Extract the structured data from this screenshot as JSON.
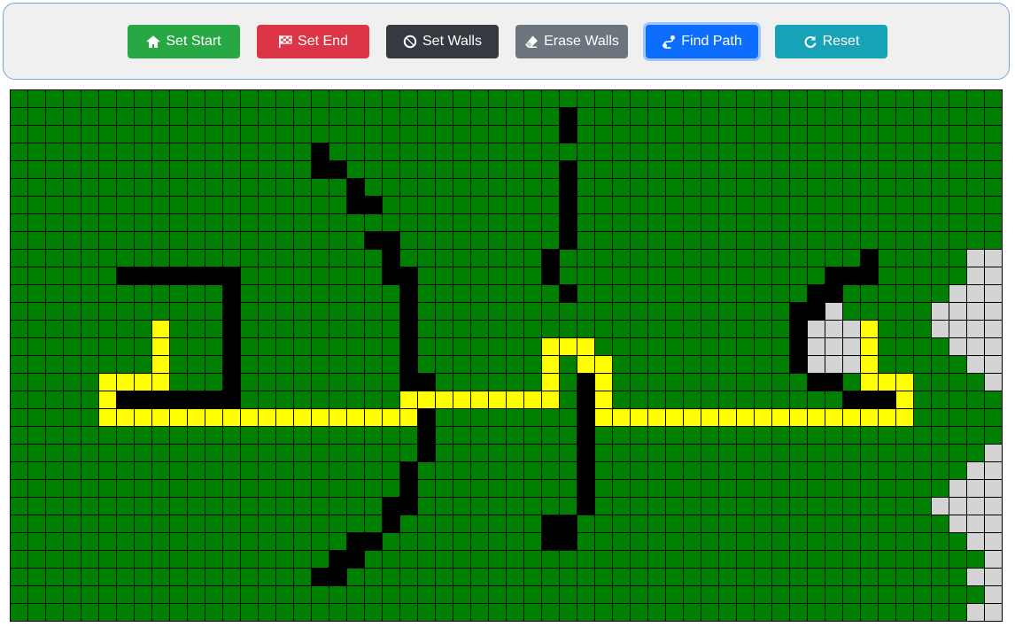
{
  "toolbar": {
    "buttons": [
      {
        "id": "set-start",
        "label": "Set Start",
        "icon": "home-icon",
        "color": "#28a745"
      },
      {
        "id": "set-end",
        "label": "Set End",
        "icon": "checkered-flag-icon",
        "color": "#dc3545"
      },
      {
        "id": "set-walls",
        "label": "Set Walls",
        "icon": "ban-icon",
        "color": "#343a40"
      },
      {
        "id": "erase-walls",
        "label": "Erase Walls",
        "icon": "eraser-icon",
        "color": "#6c757d"
      },
      {
        "id": "find-path",
        "label": "Find Path",
        "icon": "route-icon",
        "color": "#0d6efd"
      },
      {
        "id": "reset",
        "label": "Reset",
        "icon": "redo-icon",
        "color": "#17a2b8"
      }
    ]
  },
  "grid": {
    "cols": 56,
    "rows": 30,
    "colors": {
      "open": "#008000",
      "wall": "#000000",
      "path": "#ffff00",
      "visited": "#d3d3d3"
    },
    "walls": [
      [
        31,
        1
      ],
      [
        31,
        2
      ],
      [
        17,
        3
      ],
      [
        17,
        4
      ],
      [
        18,
        4
      ],
      [
        31,
        4
      ],
      [
        19,
        5
      ],
      [
        31,
        5
      ],
      [
        19,
        6
      ],
      [
        20,
        6
      ],
      [
        31,
        6
      ],
      [
        31,
        7
      ],
      [
        20,
        8
      ],
      [
        21,
        8
      ],
      [
        31,
        8
      ],
      [
        21,
        9
      ],
      [
        30,
        9
      ],
      [
        48,
        9
      ],
      [
        6,
        10
      ],
      [
        7,
        10
      ],
      [
        8,
        10
      ],
      [
        9,
        10
      ],
      [
        10,
        10
      ],
      [
        11,
        10
      ],
      [
        12,
        10
      ],
      [
        21,
        10
      ],
      [
        22,
        10
      ],
      [
        30,
        10
      ],
      [
        46,
        10
      ],
      [
        47,
        10
      ],
      [
        48,
        10
      ],
      [
        12,
        11
      ],
      [
        22,
        11
      ],
      [
        31,
        11
      ],
      [
        45,
        11
      ],
      [
        46,
        11
      ],
      [
        12,
        12
      ],
      [
        22,
        12
      ],
      [
        44,
        12
      ],
      [
        45,
        12
      ],
      [
        12,
        13
      ],
      [
        22,
        13
      ],
      [
        44,
        13
      ],
      [
        12,
        14
      ],
      [
        22,
        14
      ],
      [
        44,
        14
      ],
      [
        12,
        15
      ],
      [
        22,
        15
      ],
      [
        44,
        15
      ],
      [
        12,
        16
      ],
      [
        22,
        16
      ],
      [
        23,
        16
      ],
      [
        32,
        16
      ],
      [
        45,
        16
      ],
      [
        46,
        16
      ],
      [
        6,
        17
      ],
      [
        7,
        17
      ],
      [
        8,
        17
      ],
      [
        9,
        17
      ],
      [
        10,
        17
      ],
      [
        11,
        17
      ],
      [
        12,
        17
      ],
      [
        32,
        17
      ],
      [
        47,
        17
      ],
      [
        48,
        17
      ],
      [
        49,
        17
      ],
      [
        23,
        18
      ],
      [
        32,
        18
      ],
      [
        23,
        19
      ],
      [
        32,
        19
      ],
      [
        23,
        20
      ],
      [
        32,
        20
      ],
      [
        22,
        21
      ],
      [
        32,
        21
      ],
      [
        22,
        22
      ],
      [
        32,
        22
      ],
      [
        21,
        23
      ],
      [
        22,
        23
      ],
      [
        32,
        23
      ],
      [
        21,
        24
      ],
      [
        30,
        24
      ],
      [
        31,
        24
      ],
      [
        19,
        25
      ],
      [
        20,
        25
      ],
      [
        30,
        25
      ],
      [
        31,
        25
      ],
      [
        18,
        26
      ],
      [
        19,
        26
      ],
      [
        17,
        27
      ],
      [
        18,
        27
      ]
    ],
    "path": [
      [
        8,
        13
      ],
      [
        8,
        14
      ],
      [
        8,
        15
      ],
      [
        5,
        16
      ],
      [
        6,
        16
      ],
      [
        7,
        16
      ],
      [
        8,
        16
      ],
      [
        5,
        17
      ],
      [
        5,
        18
      ],
      [
        6,
        18
      ],
      [
        7,
        18
      ],
      [
        8,
        18
      ],
      [
        9,
        18
      ],
      [
        10,
        18
      ],
      [
        11,
        18
      ],
      [
        12,
        18
      ],
      [
        13,
        18
      ],
      [
        14,
        18
      ],
      [
        15,
        18
      ],
      [
        16,
        18
      ],
      [
        17,
        18
      ],
      [
        18,
        18
      ],
      [
        19,
        18
      ],
      [
        20,
        18
      ],
      [
        21,
        18
      ],
      [
        22,
        18
      ],
      [
        22,
        17
      ],
      [
        23,
        17
      ],
      [
        24,
        17
      ],
      [
        25,
        17
      ],
      [
        26,
        17
      ],
      [
        27,
        17
      ],
      [
        28,
        17
      ],
      [
        29,
        17
      ],
      [
        30,
        17
      ],
      [
        30,
        16
      ],
      [
        30,
        15
      ],
      [
        30,
        14
      ],
      [
        31,
        14
      ],
      [
        32,
        14
      ],
      [
        32,
        15
      ],
      [
        33,
        15
      ],
      [
        33,
        16
      ],
      [
        33,
        17
      ],
      [
        33,
        18
      ],
      [
        34,
        18
      ],
      [
        35,
        18
      ],
      [
        36,
        18
      ],
      [
        37,
        18
      ],
      [
        38,
        18
      ],
      [
        39,
        18
      ],
      [
        40,
        18
      ],
      [
        41,
        18
      ],
      [
        42,
        18
      ],
      [
        43,
        18
      ],
      [
        44,
        18
      ],
      [
        45,
        18
      ],
      [
        46,
        18
      ],
      [
        47,
        18
      ],
      [
        48,
        18
      ],
      [
        49,
        18
      ],
      [
        50,
        18
      ],
      [
        50,
        17
      ],
      [
        50,
        16
      ],
      [
        49,
        16
      ],
      [
        48,
        16
      ],
      [
        48,
        15
      ],
      [
        48,
        14
      ],
      [
        48,
        13
      ]
    ],
    "visited": [
      [
        54,
        9
      ],
      [
        55,
        9
      ],
      [
        54,
        10
      ],
      [
        55,
        10
      ],
      [
        53,
        11
      ],
      [
        54,
        11
      ],
      [
        55,
        11
      ],
      [
        46,
        12
      ],
      [
        52,
        12
      ],
      [
        53,
        12
      ],
      [
        54,
        12
      ],
      [
        55,
        12
      ],
      [
        45,
        13
      ],
      [
        46,
        13
      ],
      [
        47,
        13
      ],
      [
        52,
        13
      ],
      [
        53,
        13
      ],
      [
        54,
        13
      ],
      [
        55,
        13
      ],
      [
        45,
        14
      ],
      [
        46,
        14
      ],
      [
        47,
        14
      ],
      [
        53,
        14
      ],
      [
        54,
        14
      ],
      [
        55,
        14
      ],
      [
        45,
        15
      ],
      [
        46,
        15
      ],
      [
        47,
        15
      ],
      [
        54,
        15
      ],
      [
        55,
        15
      ],
      [
        55,
        16
      ],
      [
        55,
        20
      ],
      [
        54,
        21
      ],
      [
        55,
        21
      ],
      [
        53,
        22
      ],
      [
        54,
        22
      ],
      [
        55,
        22
      ],
      [
        52,
        23
      ],
      [
        53,
        23
      ],
      [
        54,
        23
      ],
      [
        55,
        23
      ],
      [
        53,
        24
      ],
      [
        54,
        24
      ],
      [
        55,
        24
      ],
      [
        54,
        25
      ],
      [
        55,
        25
      ],
      [
        55,
        26
      ],
      [
        54,
        27
      ],
      [
        55,
        27
      ],
      [
        55,
        28
      ],
      [
        54,
        29
      ],
      [
        55,
        29
      ]
    ]
  }
}
